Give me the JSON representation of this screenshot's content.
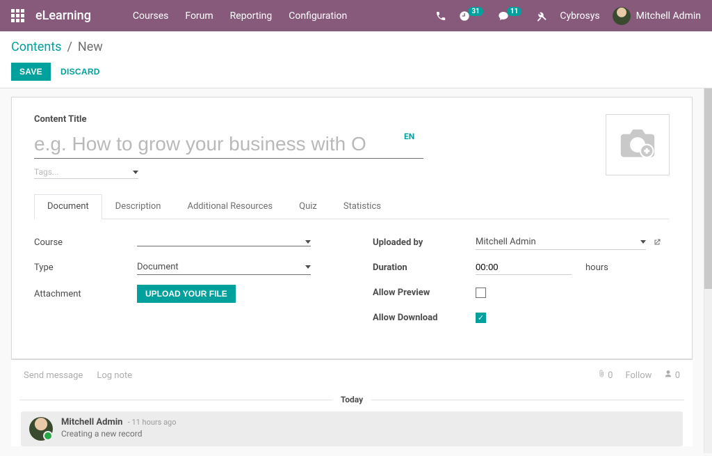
{
  "navbar": {
    "brand": "eLearning",
    "menu": [
      "Courses",
      "Forum",
      "Reporting",
      "Configuration"
    ],
    "activities_count": "31",
    "messages_count": "11",
    "company": "Cybrosys",
    "user": "Mitchell Admin"
  },
  "breadcrumb": {
    "parent": "Contents",
    "current": "New"
  },
  "buttons": {
    "save": "SAVE",
    "discard": "DISCARD"
  },
  "form": {
    "title_label": "Content Title",
    "title_placeholder": "e.g. How to grow your business with O",
    "lang_badge": "EN",
    "tags_placeholder": "Tags...",
    "tabs": [
      "Document",
      "Description",
      "Additional Resources",
      "Quiz",
      "Statistics"
    ],
    "fields": {
      "course": {
        "label": "Course",
        "value": ""
      },
      "type": {
        "label": "Type",
        "value": "Document"
      },
      "attachment": {
        "label": "Attachment",
        "button": "UPLOAD YOUR FILE"
      },
      "uploaded_by": {
        "label": "Uploaded by",
        "value": "Mitchell Admin"
      },
      "duration": {
        "label": "Duration",
        "value": "00:00",
        "unit": "hours"
      },
      "allow_preview": {
        "label": "Allow Preview",
        "checked": false
      },
      "allow_download": {
        "label": "Allow Download",
        "checked": true
      }
    }
  },
  "chatter": {
    "send_message": "Send message",
    "log_note": "Log note",
    "attach_count": "0",
    "follow": "Follow",
    "follower_count": "0",
    "separator": "Today",
    "message": {
      "author": "Mitchell Admin",
      "timestamp": "- 11 hours ago",
      "body": "Creating a new record"
    }
  }
}
